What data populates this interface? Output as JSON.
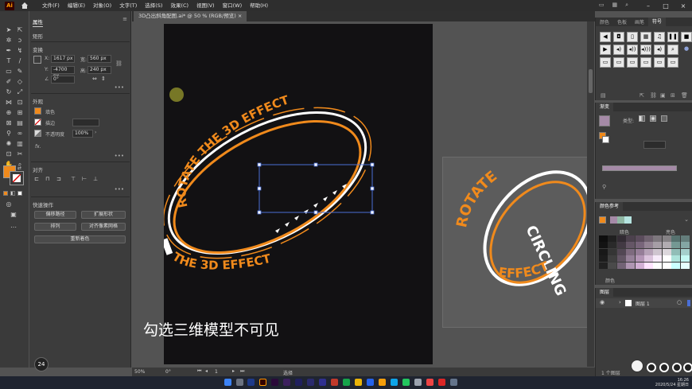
{
  "menubar": {
    "items": [
      "文件(F)",
      "编辑(E)",
      "对象(O)",
      "文字(T)",
      "选择(S)",
      "效果(C)",
      "视图(V)",
      "窗口(W)",
      "帮助(H)"
    ]
  },
  "document": {
    "tab_title": "3D凸出斜角配图.ai* @ 50 % (RGB/预览)",
    "artwork_words": {
      "line1": "THE 3D EFFECT",
      "line2": "ROTATE THE 3D EFFECT",
      "line3": "ROTATE",
      "line4": "CIRCLING",
      "line5": "EFFECT"
    }
  },
  "properties": {
    "tab": "属性",
    "object_type": "矩形",
    "transform_title": "变换",
    "x_label": "X:",
    "x_value": "1617 px",
    "y_label": "Y:",
    "y_value": "-4700 px",
    "w_label": "宽:",
    "w_value": "560 px",
    "h_label": "高:",
    "h_value": "240 px",
    "angle_value": "0°",
    "appearance_title": "外观",
    "fill_label": "填色",
    "stroke_label": "描边",
    "opacity_label": "不透明度",
    "opacity_value": "100%",
    "fx_label": "fx.",
    "align_title": "对齐",
    "quick_actions_title": "快速操作",
    "btn_offset": "偏移路径",
    "btn_expand": "扩展形状",
    "btn_arrange": "排列",
    "btn_align_pixel": "对齐像素网格",
    "btn_recolor": "重新着色"
  },
  "status": {
    "zoom": "50%",
    "rotation": "0°",
    "page": "1",
    "mode": "选择"
  },
  "subtitle": "勾选三维模型不可见",
  "right_panels": {
    "top_tabs": [
      "颜色",
      "色板",
      "画笔",
      "符号"
    ],
    "gradient_tab": "渐变",
    "gradient_type_label": "类型:",
    "color_guide_tab": "颜色参考",
    "guide_dark_label": "暗色",
    "guide_light_label": "亮色",
    "guide_footer": "颜色",
    "layers_tab": "图层",
    "layer_name": "图层 1",
    "layers_footer": "1 个图层"
  },
  "badge": "24",
  "clock": {
    "time": "16:26",
    "date": "2020/5/24 星期日"
  },
  "colors": {
    "accent": "#f08a1c",
    "artboard": "#121113",
    "selection": "#4a6fd6",
    "gradient": "#a58aa7"
  }
}
